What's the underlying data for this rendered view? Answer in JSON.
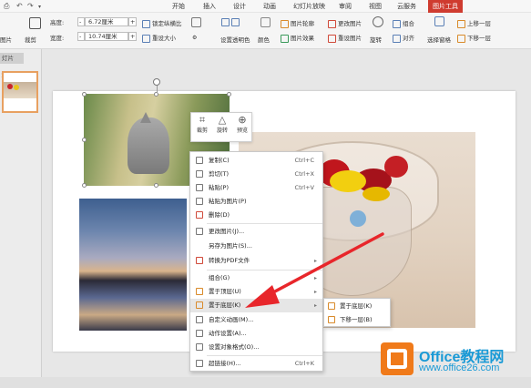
{
  "menu_tabs": [
    "开始",
    "插入",
    "设计",
    "动画",
    "幻灯片放映",
    "审阅",
    "视图",
    "云服务",
    "图片工具"
  ],
  "ribbon": {
    "left_cut": "图片",
    "crop": "裁剪",
    "height_label": "高度:",
    "height_value": "6.72厘米",
    "width_label": "宽度:",
    "width_value": "10.74厘米",
    "lock_ratio": "锁定纵横比",
    "reset_size": "重设大小",
    "set_transparent": "设置透明色",
    "color": "颜色",
    "picture_outline": "图片轮廓",
    "picture_effect": "图片效果",
    "change_picture": "更改图片",
    "reset_picture": "重设图片",
    "rotate": "旋转",
    "group": "组合",
    "align": "对齐",
    "selection_pane": "选择窗格",
    "bring_forward": "上移一层",
    "send_backward": "下移一层",
    "minus": "-",
    "plus": "+"
  },
  "left_panel": {
    "tab": "灯片",
    "slide_number": "1"
  },
  "mini_toolbar": {
    "crop": "裁剪",
    "rotate": "旋转",
    "preview": "预览"
  },
  "context_menu": [
    {
      "label": "复制(C)",
      "shortcut": "Ctrl+C"
    },
    {
      "label": "剪切(T)",
      "shortcut": "Ctrl+X"
    },
    {
      "label": "粘贴(P)",
      "shortcut": "Ctrl+V"
    },
    {
      "label": "粘贴为图片(P)",
      "shortcut": ""
    },
    {
      "label": "删除(D)",
      "shortcut": ""
    },
    {
      "label": "更改图片(J)...",
      "shortcut": ""
    },
    {
      "label": "另存为图片(S)...",
      "shortcut": ""
    },
    {
      "label": "转换为PDF文件",
      "shortcut": ""
    },
    {
      "label": "组合(G)",
      "shortcut": ""
    },
    {
      "label": "置于顶层(U)",
      "shortcut": ""
    },
    {
      "label": "置于底层(K)",
      "shortcut": ""
    },
    {
      "label": "自定义动画(M)...",
      "shortcut": ""
    },
    {
      "label": "动作设置(A)...",
      "shortcut": ""
    },
    {
      "label": "设置对象格式(O)...",
      "shortcut": ""
    },
    {
      "label": "超链接(H)...",
      "shortcut": "Ctrl+K"
    }
  ],
  "submenu": [
    "置于底层(K)",
    "下移一层(B)"
  ],
  "watermark": {
    "brand": "Office教程网",
    "url": "www.office26.com"
  },
  "colors": {
    "accent": "#cf3b2f",
    "arrow": "#e8262b",
    "watermark": "#1a9ad6",
    "logo": "#f07a1a"
  }
}
